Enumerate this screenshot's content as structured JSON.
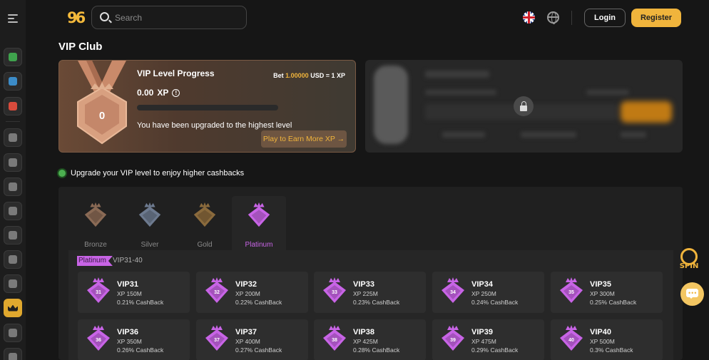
{
  "header": {
    "logo_text": "96",
    "search_placeholder": "Search",
    "login_label": "Login",
    "register_label": "Register"
  },
  "sidebar": {
    "items": [
      {
        "icon": "grid-game-icon",
        "color": "#3fa34d"
      },
      {
        "icon": "casino-icon",
        "color": "#3c8cc8"
      },
      {
        "icon": "sports-icon",
        "color": "#d94b3c"
      },
      {
        "icon": "chip-icon",
        "color": "#7a7a7a"
      },
      {
        "icon": "rocket-icon",
        "color": "#7a7a7a"
      },
      {
        "icon": "slot-seven-icon",
        "color": "#7a7a7a"
      },
      {
        "icon": "dice-icon",
        "color": "#7a7a7a"
      },
      {
        "icon": "cards-icon",
        "color": "#7a7a7a"
      },
      {
        "icon": "ball-icon",
        "color": "#7a7a7a"
      },
      {
        "icon": "roulette-icon",
        "color": "#7a7a7a"
      },
      {
        "icon": "crown-icon",
        "color": "#1f1f1f",
        "active": true
      },
      {
        "icon": "trophy-icon",
        "color": "#7a7a7a"
      },
      {
        "icon": "fire-icon",
        "color": "#7a7a7a"
      }
    ]
  },
  "page": {
    "title": "VIP Club"
  },
  "progress": {
    "title": "VIP Level Progress",
    "bet_prefix": "Bet",
    "bet_amount": "1.00000",
    "bet_suffix": "USD = 1 XP",
    "xp_value": "0.00",
    "xp_unit": "XP",
    "progress_fraction": 0,
    "medal_level": "0",
    "status_text": "You have been upgraded to the highest level",
    "earn_button": "Play to Earn More XP →"
  },
  "hint": {
    "text": "Upgrade your VIP level to enjoy higher cashbacks"
  },
  "tiers": {
    "tabs": [
      {
        "label": "Bronze",
        "color": "#8a6a55"
      },
      {
        "label": "Silver",
        "color": "#6d7a8f"
      },
      {
        "label": "Gold",
        "color": "#8a6a3c"
      },
      {
        "label": "Platinum",
        "color": "#c864e6",
        "active": true
      }
    ],
    "selected_tag": "Platinum",
    "selected_range": "VIP31-40"
  },
  "vip_levels": [
    {
      "name": "VIP31",
      "num": "31",
      "xp": "XP 150M",
      "cashback": "0.21% CashBack"
    },
    {
      "name": "VIP32",
      "num": "32",
      "xp": "XP 200M",
      "cashback": "0.22% CashBack"
    },
    {
      "name": "VIP33",
      "num": "33",
      "xp": "XP 225M",
      "cashback": "0.23% CashBack"
    },
    {
      "name": "VIP34",
      "num": "34",
      "xp": "XP 250M",
      "cashback": "0.24% CashBack"
    },
    {
      "name": "VIP35",
      "num": "35",
      "xp": "XP 300M",
      "cashback": "0.25% CashBack"
    },
    {
      "name": "VIP36",
      "num": "36",
      "xp": "XP 350M",
      "cashback": "0.26% CashBack"
    },
    {
      "name": "VIP37",
      "num": "37",
      "xp": "XP 400M",
      "cashback": "0.27% CashBack"
    },
    {
      "name": "VIP38",
      "num": "38",
      "xp": "XP 425M",
      "cashback": "0.28% CashBack"
    },
    {
      "name": "VIP39",
      "num": "39",
      "xp": "XP 475M",
      "cashback": "0.29% CashBack"
    },
    {
      "name": "VIP40",
      "num": "40",
      "xp": "XP 500M",
      "cashback": "0.3% CashBack"
    }
  ],
  "floating": {
    "spin_label": "SPIN"
  }
}
